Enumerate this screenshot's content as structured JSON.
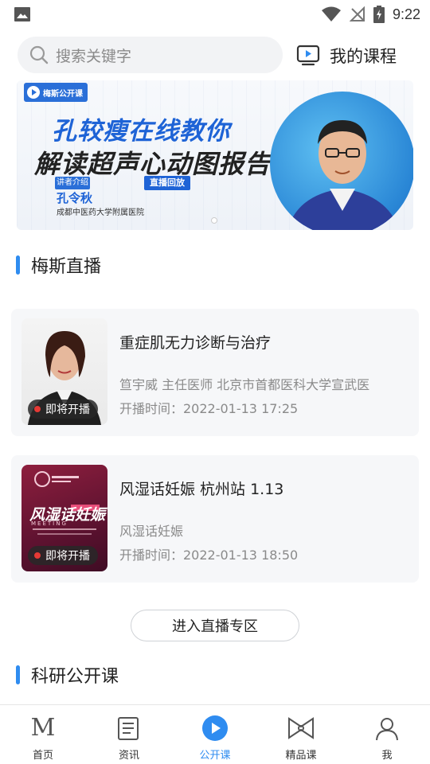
{
  "status_bar": {
    "time": "9:22"
  },
  "header": {
    "search_placeholder": "搜索关键字",
    "my_courses_label": "我的课程"
  },
  "banner": {
    "tag": "梅斯公开课",
    "title_line1": "孔较瘦在线教你",
    "title_line2": "解读超声心动图报告",
    "speaker_tag": "讲者介绍",
    "speaker_name": "孔令秋",
    "hospital": "成都中医药大学附属医院",
    "replay_tag": "直播回放"
  },
  "live_section": {
    "title": "梅斯直播",
    "courses": [
      {
        "title": "重症肌无力诊断与治疗",
        "subtitle": "笪宇威 主任医师 北京市首都医科大学宣武医",
        "time": "开播时间：2022-01-13 17:25",
        "badge": "即将开播"
      },
      {
        "title": "风湿话妊娠 杭州站 1.13",
        "subtitle": "风湿话妊娠",
        "time": "开播时间：2022-01-13 18:50",
        "badge": "即将开播",
        "poster_line1": "风湿话妊娠",
        "poster_word": "MEETING"
      }
    ],
    "enter_button": "进入直播专区"
  },
  "research_section": {
    "title": "科研公开课"
  },
  "tabs": [
    {
      "label": "首页",
      "icon": "m-logo-icon",
      "active": false
    },
    {
      "label": "资讯",
      "icon": "news-icon",
      "active": false
    },
    {
      "label": "公开课",
      "icon": "play-icon",
      "active": true
    },
    {
      "label": "精品课",
      "icon": "bow-icon",
      "active": false
    },
    {
      "label": "我",
      "icon": "user-icon",
      "active": false
    }
  ],
  "colors": {
    "accent": "#2f8cf0",
    "badge_dot": "#e53935"
  }
}
